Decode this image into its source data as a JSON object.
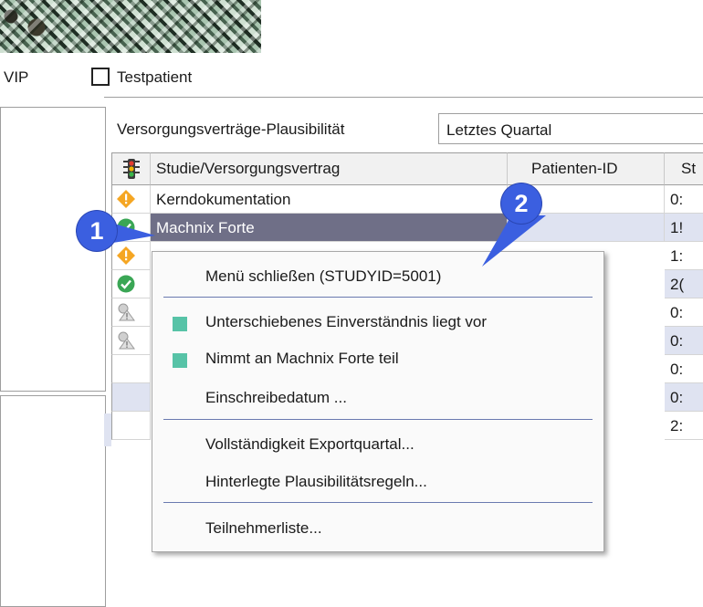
{
  "header": {
    "vip_label": "VIP",
    "testpatient_label": "Testpatient"
  },
  "filter": {
    "label": "Versorgungsverträge-Plausibilität",
    "selected": "Letztes Quartal"
  },
  "grid": {
    "columns": [
      "Studie/Versorgungsvertrag",
      "Patienten-ID",
      "St"
    ],
    "rows": [
      {
        "status": "warning-icon",
        "name": "Kerndokumentation",
        "id": "",
        "st": "0:"
      },
      {
        "status": "check-icon",
        "name": "Machnix Forte",
        "id": "",
        "st": "1!"
      },
      {
        "status": "warning-icon",
        "name": "",
        "id": "",
        "st": "1:"
      },
      {
        "status": "check-icon",
        "name": "",
        "id": "",
        "st": "2("
      },
      {
        "status": "grey-warning-icon",
        "name": "",
        "id": "",
        "st": "0:"
      },
      {
        "status": "grey-warning-icon",
        "name": "",
        "id": "",
        "st": "0:"
      },
      {
        "status": "",
        "name": "",
        "id": "",
        "st": "0:"
      },
      {
        "status": "",
        "name": "",
        "id": "",
        "st": "0:"
      },
      {
        "status": "",
        "name": "",
        "id": "",
        "st": "2:"
      }
    ]
  },
  "context_menu": {
    "close_label": "Menü schließen (STUDYID=5001)",
    "item_consent": "Unterschiebenes Einverständnis liegt vor",
    "item_participates": "Nimmt an Machnix Forte teil",
    "item_enroll_date": "Einschreibedatum ...",
    "item_completeness": "Vollständigkeit Exportquartal...",
    "item_rules": "Hinterlegte Plausibilitätsregeln...",
    "item_participants": "Teilnehmerliste..."
  },
  "badges": {
    "one": "1",
    "two": "2"
  },
  "colors": {
    "selection": "#6f6f87",
    "accent_square": "#57c3a7",
    "badge": "#3b5fe0",
    "separator": "#6a7ab0"
  }
}
